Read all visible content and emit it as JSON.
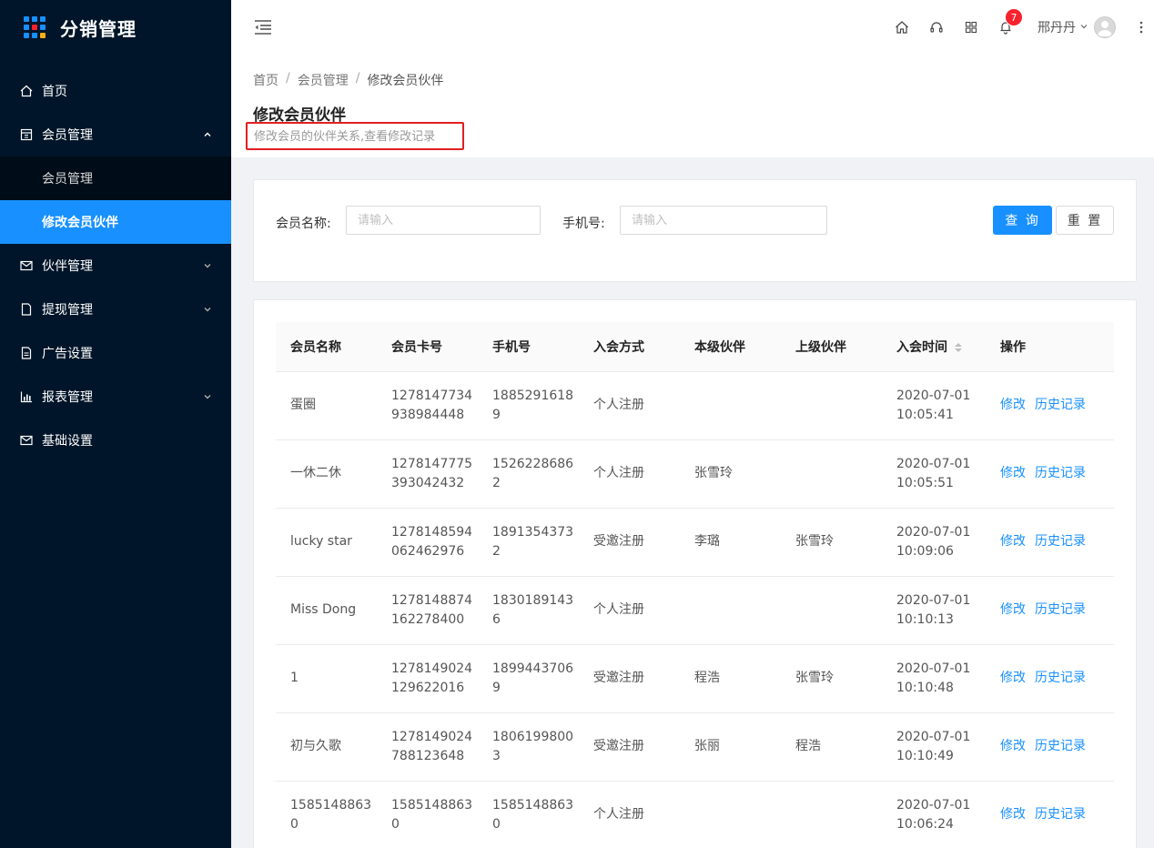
{
  "app": {
    "title": "分销管理"
  },
  "colors": {
    "sidebar_bg": "#001529",
    "primary": "#1890ff",
    "badge": "#f5222d",
    "highlight_border": "#e02020"
  },
  "sidebar": {
    "items": [
      {
        "label": "首页",
        "icon": "home-icon"
      },
      {
        "label": "会员管理",
        "icon": "calculator-icon",
        "expanded": true,
        "children": [
          {
            "label": "会员管理"
          },
          {
            "label": "修改会员伙伴",
            "active": true
          }
        ]
      },
      {
        "label": "伙伴管理",
        "icon": "mail-icon"
      },
      {
        "label": "提现管理",
        "icon": "file-icon"
      },
      {
        "label": "广告设置",
        "icon": "document-icon"
      },
      {
        "label": "报表管理",
        "icon": "bar-chart-icon"
      },
      {
        "label": "基础设置",
        "icon": "mail-icon"
      }
    ]
  },
  "header": {
    "notification_count": "7",
    "user_name": "邢丹丹"
  },
  "breadcrumb": [
    "首页",
    "会员管理",
    "修改会员伙伴"
  ],
  "page": {
    "title": "修改会员伙伴",
    "description": "修改会员的伙伴关系,查看修改记录"
  },
  "search": {
    "member_name_label": "会员名称:",
    "member_name_placeholder": "请输入",
    "phone_label": "手机号:",
    "phone_placeholder": "请输入",
    "query_label": "查 询",
    "reset_label": "重 置"
  },
  "table": {
    "columns": [
      "会员名称",
      "会员卡号",
      "手机号",
      "入会方式",
      "本级伙伴",
      "上级伙伴",
      "入会时间",
      "操作"
    ],
    "edit_label": "修改",
    "history_label": "历史记录",
    "rows": [
      {
        "name": "蛋圈",
        "card": "1278147734938984448",
        "phone": "18852916189",
        "method": "个人注册",
        "partner": "",
        "parent": "",
        "date": "2020-07-01",
        "time": "10:05:41"
      },
      {
        "name": "一休二休",
        "card": "1278147775393042432",
        "phone": "15262286862",
        "method": "个人注册",
        "partner": "张雪玲",
        "parent": "",
        "date": "2020-07-01",
        "time": "10:05:51"
      },
      {
        "name": "lucky star",
        "card": "1278148594062462976",
        "phone": "18913543732",
        "method": "受邀注册",
        "partner": "李璐",
        "parent": "张雪玲",
        "date": "2020-07-01",
        "time": "10:09:06"
      },
      {
        "name": "Miss Dong",
        "card": "1278148874162278400",
        "phone": "18301891436",
        "method": "个人注册",
        "partner": "",
        "parent": "",
        "date": "2020-07-01",
        "time": "10:10:13"
      },
      {
        "name": "1",
        "card": "1278149024129622016",
        "phone": "18994437069",
        "method": "受邀注册",
        "partner": "程浩",
        "parent": "张雪玲",
        "date": "2020-07-01",
        "time": "10:10:48"
      },
      {
        "name": "初与久歌",
        "card": "1278149024788123648",
        "phone": "18061998003",
        "method": "受邀注册",
        "partner": "张丽",
        "parent": "程浩",
        "date": "2020-07-01",
        "time": "10:10:49"
      },
      {
        "name": "15851488630",
        "card": "15851488630",
        "phone": "15851488630",
        "method": "个人注册",
        "partner": "",
        "parent": "",
        "date": "2020-07-01",
        "time": "10:06:24"
      }
    ]
  }
}
